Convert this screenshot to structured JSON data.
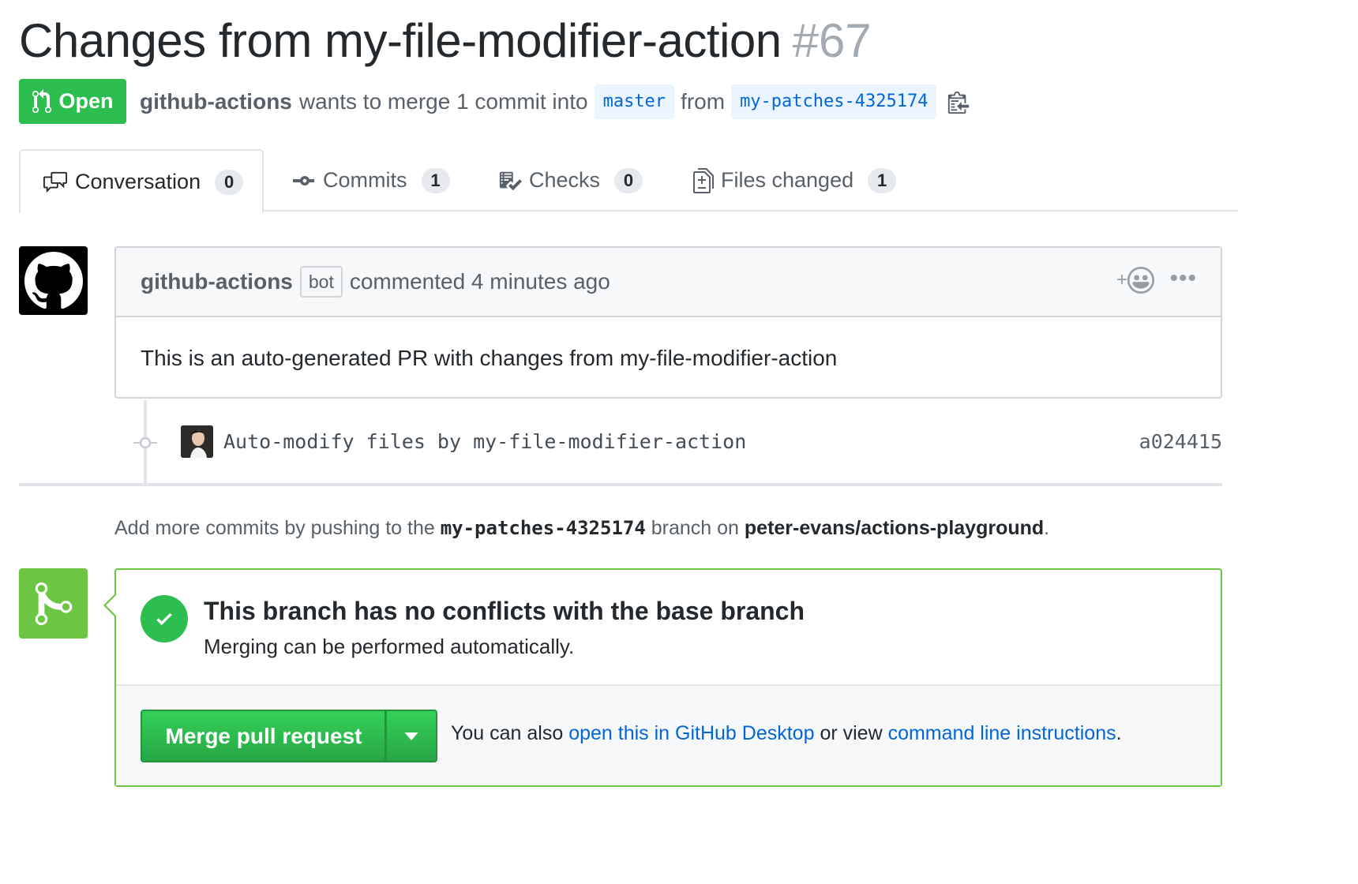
{
  "pr": {
    "title": "Changes from my-file-modifier-action",
    "number": "#67",
    "state": "Open",
    "author": "github-actions",
    "merge_text_1": "wants to merge 1 commit into",
    "base_branch": "master",
    "from_word": "from",
    "head_branch": "my-patches-4325174"
  },
  "tabs": [
    {
      "label": "Conversation",
      "count": "0",
      "icon": "comment-discussion-icon"
    },
    {
      "label": "Commits",
      "count": "1",
      "icon": "git-commit-icon"
    },
    {
      "label": "Checks",
      "count": "0",
      "icon": "checklist-icon"
    },
    {
      "label": "Files changed",
      "count": "1",
      "icon": "file-diff-icon"
    }
  ],
  "comment": {
    "author": "github-actions",
    "badge": "bot",
    "time": "commented 4 minutes ago",
    "reaction_plus": "+",
    "more": "•••",
    "body": "This is an auto-generated PR with changes from my-file-modifier-action"
  },
  "commit": {
    "message": "Auto-modify files by my-file-modifier-action",
    "sha": "a024415"
  },
  "hint": {
    "prefix": "Add more commits by pushing to the",
    "branch": "my-patches-4325174",
    "middle": "branch on",
    "repo": "peter-evans/actions-playground",
    "suffix": "."
  },
  "merge": {
    "status_title": "This branch has no conflicts with the base branch",
    "status_sub": "Merging can be performed automatically.",
    "button_label": "Merge pull request",
    "alt_prefix": "You can also",
    "alt_link1": "open this in GitHub Desktop",
    "alt_middle": "or view",
    "alt_link2": "command line instructions",
    "alt_suffix": "."
  },
  "colors": {
    "open_green": "#2cbe4e",
    "link_blue": "#0366d6",
    "merge_border": "#6cc644"
  }
}
